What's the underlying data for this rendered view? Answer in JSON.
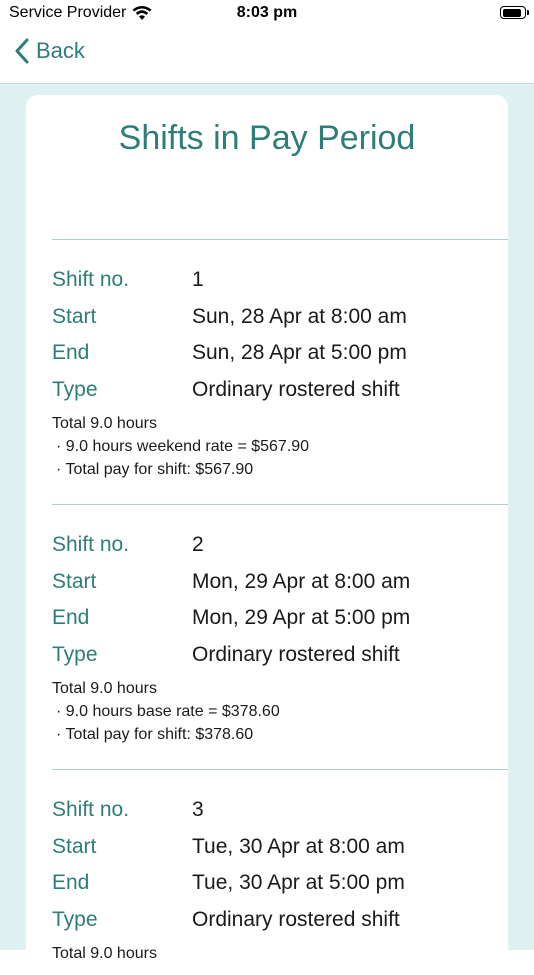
{
  "status_bar": {
    "carrier": "Service Provider",
    "time": "8:03 pm",
    "battery_level": 0.9
  },
  "nav": {
    "back_label": "Back"
  },
  "page": {
    "title": "Shifts in Pay Period"
  },
  "labels": {
    "shift_no": "Shift no.",
    "start": "Start",
    "end": "End",
    "type": "Type"
  },
  "shifts": [
    {
      "number": "1",
      "start": "Sun, 28 Apr at 8:00 am",
      "end": "Sun, 28 Apr at 5:00 pm",
      "type": "Ordinary rostered shift",
      "total": "Total 9.0 hours",
      "rate_line": "· 9.0 hours weekend rate = $567.90",
      "pay_line": "· Total pay for shift: $567.90"
    },
    {
      "number": "2",
      "start": "Mon, 29 Apr at 8:00 am",
      "end": "Mon, 29 Apr at 5:00 pm",
      "type": "Ordinary rostered shift",
      "total": "Total 9.0 hours",
      "rate_line": "· 9.0 hours base rate = $378.60",
      "pay_line": "· Total pay for shift: $378.60"
    },
    {
      "number": "3",
      "start": "Tue, 30 Apr at 8:00 am",
      "end": "Tue, 30 Apr at 5:00 pm",
      "type": "Ordinary rostered shift",
      "total": "Total 9.0 hours",
      "rate_line": "",
      "pay_line": ""
    }
  ]
}
